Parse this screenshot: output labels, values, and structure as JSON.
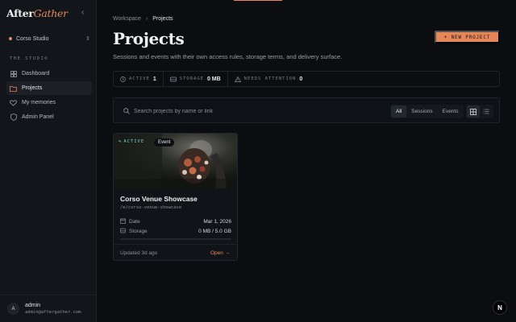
{
  "brand": {
    "name_part1": "After",
    "name_part2": "Gather",
    "accent": "#e6875a"
  },
  "sidebar": {
    "collapse_icon": "chevron-left-icon",
    "studio": {
      "name": "Corso Studio"
    },
    "section_label": "THE STUDIO",
    "items": [
      {
        "label": "Dashboard",
        "icon": "grid-icon",
        "active": false
      },
      {
        "label": "Projects",
        "icon": "folder-icon",
        "active": true
      },
      {
        "label": "My memories",
        "icon": "heart-icon",
        "active": false
      },
      {
        "label": "Admin Panel",
        "icon": "shield-icon",
        "active": false
      }
    ],
    "user": {
      "initial": "A",
      "name": "admin",
      "email": "admin@aftergather.com"
    }
  },
  "breadcrumb": {
    "parent": "Workspace",
    "current": "Projects"
  },
  "page": {
    "title": "Projects",
    "subtitle": "Sessions and events with their own access rules, storage terms, and delivery surface.",
    "new_button": "+ NEW PROJECT"
  },
  "stats": [
    {
      "label": "ACTIVE",
      "value": "1",
      "icon": "clock-icon"
    },
    {
      "label": "STORAGE",
      "value": "0 MB",
      "icon": "drive-icon"
    },
    {
      "label": "NEEDS ATTENTION",
      "value": "0",
      "icon": "warning-icon"
    }
  ],
  "filters": {
    "search_placeholder": "Search projects by name or link",
    "segments": [
      {
        "label": "All",
        "active": true
      },
      {
        "label": "Sessions",
        "active": false
      },
      {
        "label": "Events",
        "active": false
      }
    ],
    "view": "grid"
  },
  "projects": [
    {
      "status": "ACTIVE",
      "type": "Event",
      "title": "Corso Venue Showcase",
      "link": "/e/corso-venue-showcase",
      "date_label": "Date",
      "date_value": "Mar 1, 2026",
      "storage_label": "Storage",
      "storage_value": "0 MB / 5.0 GB",
      "storage_used_fraction": 0.0,
      "updated": "Updated 3d ago",
      "open_label": "Open →"
    }
  ],
  "corner_badge": "N"
}
